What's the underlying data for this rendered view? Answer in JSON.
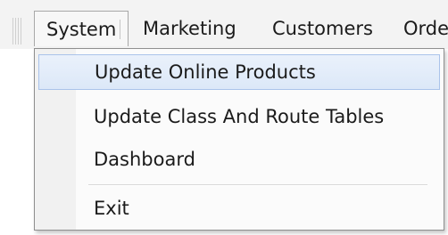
{
  "menubar": {
    "items": [
      {
        "label": "System"
      },
      {
        "label": "Marketing"
      },
      {
        "label": "Customers"
      },
      {
        "label": "Orde"
      }
    ]
  },
  "dropdown": {
    "items": [
      {
        "label": "Update Online Products"
      },
      {
        "label": "Update Class And Route Tables"
      },
      {
        "label": "Dashboard"
      },
      {
        "label": "Exit"
      }
    ]
  },
  "colors": {
    "highlight": "#dce8f8",
    "highlight_border": "#aac3ea",
    "menubar_bg": "#f3f3f3"
  }
}
